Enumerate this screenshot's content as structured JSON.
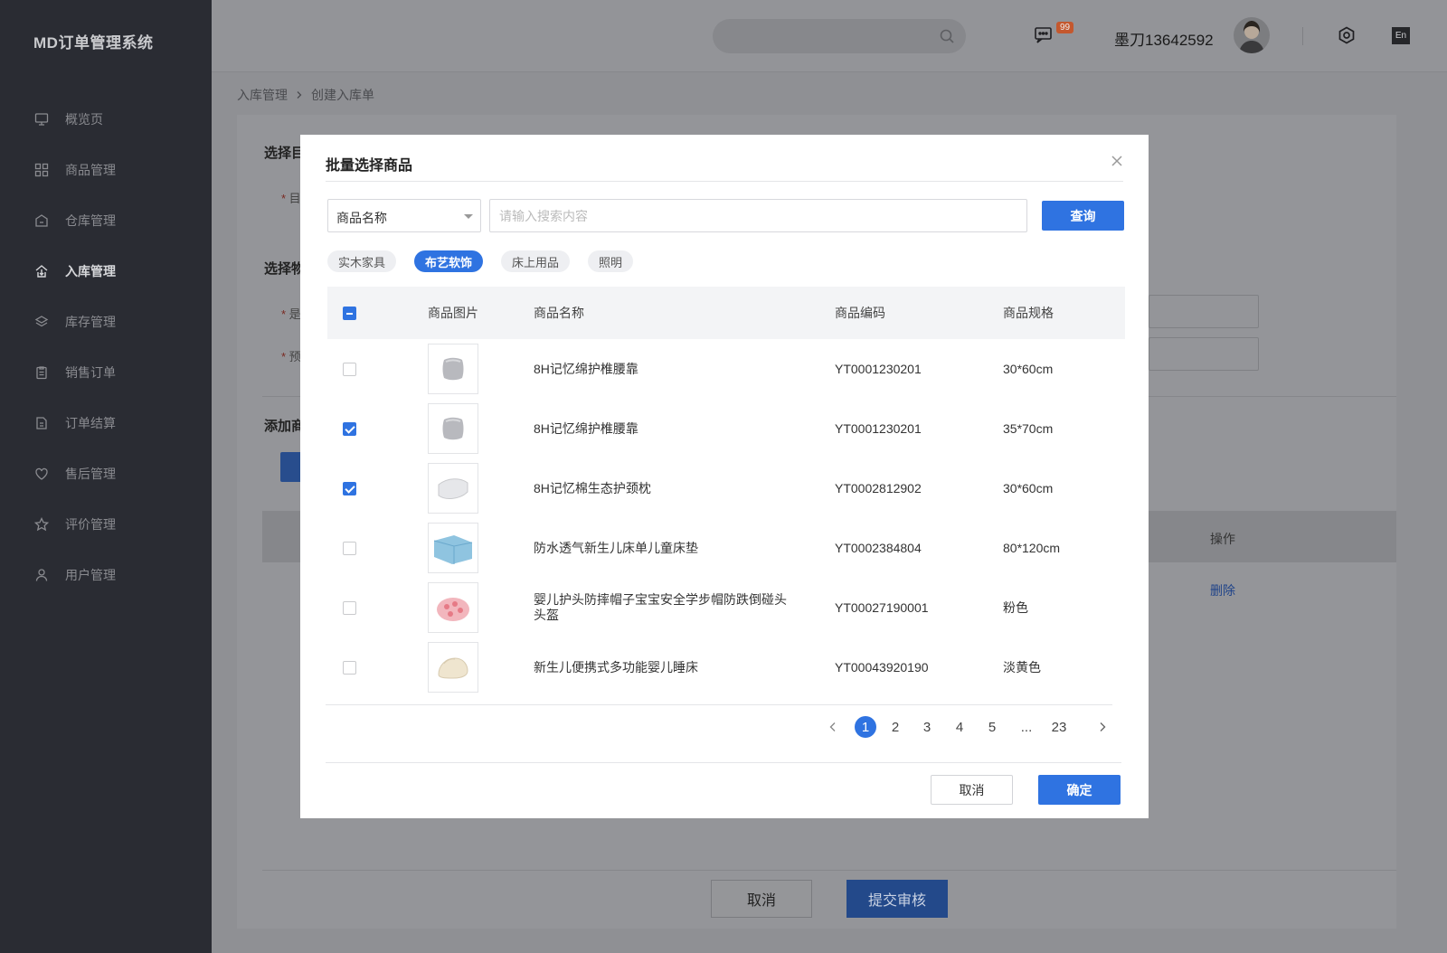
{
  "app": {
    "brand": "MD订单管理系统"
  },
  "sidebar": {
    "items": [
      {
        "label": "概览页",
        "icon": "monitor-icon"
      },
      {
        "label": "商品管理",
        "icon": "grid-icon"
      },
      {
        "label": "仓库管理",
        "icon": "warehouse-icon"
      },
      {
        "label": "入库管理",
        "icon": "inbound-icon",
        "active": true
      },
      {
        "label": "库存管理",
        "icon": "layers-icon"
      },
      {
        "label": "销售订单",
        "icon": "clipboard-icon"
      },
      {
        "label": "订单结算",
        "icon": "settlement-icon"
      },
      {
        "label": "售后管理",
        "icon": "heart-icon"
      },
      {
        "label": "评价管理",
        "icon": "star-icon"
      },
      {
        "label": "用户管理",
        "icon": "user-icon"
      }
    ]
  },
  "header": {
    "message_badge": "99",
    "username": "墨刀13642592",
    "lang": "En"
  },
  "breadcrumb": {
    "parent": "入库管理",
    "current": "创建入库单"
  },
  "background": {
    "section1_title": "选择目",
    "section1_field": "目",
    "section2_title": "选择物",
    "section2_field1": "是",
    "section2_field2": "预",
    "section3_title": "添加商",
    "table_action_header": "操作",
    "table_row_delete": "删除",
    "cancel_label": "取消",
    "submit_label": "提交审核"
  },
  "modal": {
    "title": "批量选择商品",
    "search": {
      "field_select": "商品名称",
      "placeholder": "请输入搜索内容",
      "query_label": "查询"
    },
    "tags": [
      {
        "label": "实木家具",
        "active": false
      },
      {
        "label": "布艺软饰",
        "active": true
      },
      {
        "label": "床上用品",
        "active": false
      },
      {
        "label": "照明",
        "active": false
      }
    ],
    "columns": {
      "image": "商品图片",
      "name": "商品名称",
      "code": "商品编码",
      "spec": "商品规格"
    },
    "rows": [
      {
        "name": "8H记忆绵护椎腰靠",
        "code": "YT0001230201",
        "spec": "30*60cm",
        "checked": false,
        "thumb": "lumbar-pillow"
      },
      {
        "name": "8H记忆绵护椎腰靠",
        "code": "YT0001230201",
        "spec": "35*70cm",
        "checked": true,
        "thumb": "lumbar-pillow"
      },
      {
        "name": "8H记忆棉生态护颈枕",
        "code": "YT0002812902",
        "spec": "30*60cm",
        "checked": true,
        "thumb": "neck-pillow"
      },
      {
        "name": "防水透气新生儿床单儿童床垫",
        "code": "YT0002384804",
        "spec": "80*120cm",
        "checked": false,
        "thumb": "bed-pad"
      },
      {
        "name": "婴儿护头防摔帽子宝宝安全学步帽防跌倒碰头头盔",
        "code": "YT00027190001",
        "spec": "粉色",
        "checked": false,
        "thumb": "baby-helmet"
      },
      {
        "name": "新生儿便携式多功能婴儿睡床",
        "code": "YT00043920190",
        "spec": "淡黄色",
        "checked": false,
        "thumb": "baby-bed"
      }
    ],
    "pagination": {
      "pages": [
        "1",
        "2",
        "3",
        "4",
        "5"
      ],
      "ellipsis": "...",
      "last": "23",
      "current": "1"
    },
    "footer": {
      "cancel_label": "取消",
      "confirm_label": "确定"
    }
  },
  "colors": {
    "primary": "#2f73e1",
    "sidebar_bg": "#2a2c33",
    "badge": "#c4582e"
  }
}
